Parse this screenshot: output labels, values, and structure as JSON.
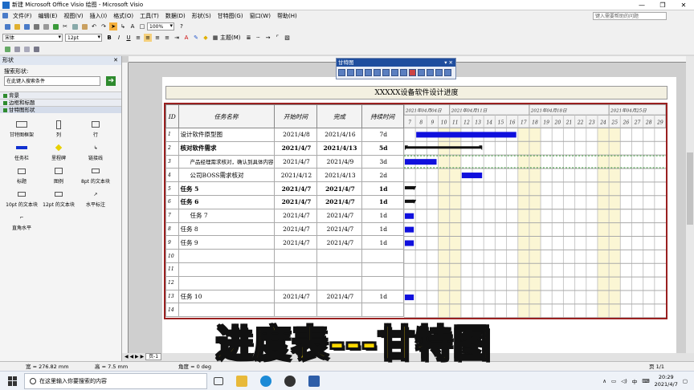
{
  "window": {
    "title": "新建 Microsoft Office Visio 绘图 - Microsoft Visio",
    "min": "—",
    "max": "❐",
    "close": "✕"
  },
  "menu": {
    "items": [
      "文件(F)",
      "编辑(E)",
      "视图(V)",
      "插入(I)",
      "格式(O)",
      "工具(T)",
      "数据(D)",
      "形状(S)",
      "甘特图(G)",
      "窗口(W)",
      "帮助(H)"
    ],
    "help_placeholder": "键入需要帮助的问题"
  },
  "toolbar": {
    "zoom": "100%",
    "font": "宋体",
    "font_size": "12pt",
    "theme_label": "主题(M)",
    "bold": "B",
    "italic": "I",
    "underline": "U"
  },
  "shapes_panel": {
    "title": "形状",
    "search_label": "搜索形状:",
    "search_placeholder": "在此键入搜索条件",
    "stencils": [
      "背景",
      "边框和标题",
      "甘特图形状"
    ],
    "items": [
      "甘特图框架",
      "列",
      "行",
      "任务栏",
      "里程碑",
      "链接线",
      "标题",
      "图例",
      "8pt 的文本块",
      "10pt 的文本块",
      "12pt 的文本块",
      "水平标注",
      "直角水平"
    ]
  },
  "gantt_toolbar": {
    "title": "甘特图"
  },
  "gantt": {
    "title": "XXXXX设备软件设计进度",
    "headers": [
      "ID",
      "任务名称",
      "开始时间",
      "完成",
      "持续时间"
    ],
    "weeks": [
      "2021年04月04日",
      "2021年04月11日",
      "2021年04月18日",
      "2021年04月25日"
    ],
    "days": [
      "7",
      "8",
      "9",
      "10",
      "11",
      "12",
      "13",
      "14",
      "15",
      "16",
      "17",
      "18",
      "19",
      "20",
      "21",
      "22",
      "23",
      "24",
      "25",
      "26",
      "27",
      "28",
      "29"
    ],
    "rows": [
      {
        "id": "1",
        "name": "设计软件原型图",
        "start": "2021/4/8",
        "end": "2021/4/16",
        "dur": "7d"
      },
      {
        "id": "2",
        "name": "核对软件需求",
        "start": "2021/4/7",
        "end": "2021/4/13",
        "dur": "5d"
      },
      {
        "id": "3",
        "name": "产品经理需求核对，确认到具体内容",
        "start": "2021/4/7",
        "end": "2021/4/9",
        "dur": "3d"
      },
      {
        "id": "4",
        "name": "公司BOSS需求核对",
        "start": "2021/4/12",
        "end": "2021/4/13",
        "dur": "2d"
      },
      {
        "id": "5",
        "name": "任务 5",
        "start": "2021/4/7",
        "end": "2021/4/7",
        "dur": "1d"
      },
      {
        "id": "6",
        "name": "任务 6",
        "start": "2021/4/7",
        "end": "2021/4/7",
        "dur": "1d"
      },
      {
        "id": "7",
        "name": "任务 7",
        "start": "2021/4/7",
        "end": "2021/4/7",
        "dur": "1d"
      },
      {
        "id": "8",
        "name": "任务 8",
        "start": "2021/4/7",
        "end": "2021/4/7",
        "dur": "1d"
      },
      {
        "id": "9",
        "name": "任务 9",
        "start": "2021/4/7",
        "end": "2021/4/7",
        "dur": "1d"
      },
      {
        "id": "10",
        "name": "",
        "start": "",
        "end": "",
        "dur": ""
      },
      {
        "id": "11",
        "name": "",
        "start": "",
        "end": "",
        "dur": ""
      },
      {
        "id": "12",
        "name": "",
        "start": "",
        "end": "",
        "dur": ""
      },
      {
        "id": "13",
        "name": "任务 10",
        "start": "2021/4/7",
        "end": "2021/4/7",
        "dur": "1d"
      },
      {
        "id": "14",
        "name": "",
        "start": "",
        "end": "",
        "dur": ""
      }
    ]
  },
  "caption": "进度表---甘特图",
  "status": {
    "width": "宽 = 276.82 mm",
    "height": "高 = 7.5 mm",
    "angle": "角度 = 0 deg",
    "page": "页 1/1"
  },
  "page_tab": "页-1",
  "taskbar": {
    "search": "在这里输入你要搜索的内容",
    "time": "20:29",
    "date": "2021/4/7",
    "ime": "中"
  }
}
